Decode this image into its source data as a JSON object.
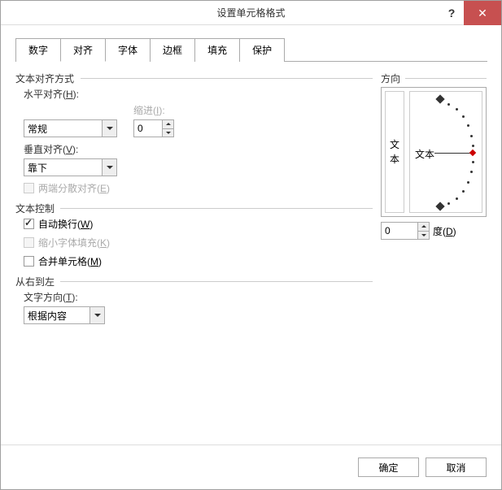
{
  "title": "设置单元格格式",
  "tabs": [
    "数字",
    "对齐",
    "字体",
    "边框",
    "填充",
    "保护"
  ],
  "active_tab": 1,
  "sections": {
    "text_align": "文本对齐方式",
    "text_control": "文本控制",
    "rtl": "从右到左",
    "orientation": "方向"
  },
  "labels": {
    "h_align": "水平对齐(H):",
    "v_align": "垂直对齐(V):",
    "indent": "缩进(I):",
    "justify": "两端分散对齐(E)",
    "wrap": "自动换行(W)",
    "shrink": "缩小字体填充(K)",
    "merge": "合并单元格(M)",
    "text_dir": "文字方向(T):",
    "degree": "度(D)",
    "vert_text_1": "文",
    "vert_text_2": "本",
    "arc_text": "文本"
  },
  "values": {
    "h_align": "常规",
    "v_align": "靠下",
    "indent": "0",
    "text_dir": "根据内容",
    "degree": "0"
  },
  "checkboxes": {
    "justify": false,
    "wrap": true,
    "shrink": false,
    "merge": false
  },
  "buttons": {
    "ok": "确定",
    "cancel": "取消"
  }
}
